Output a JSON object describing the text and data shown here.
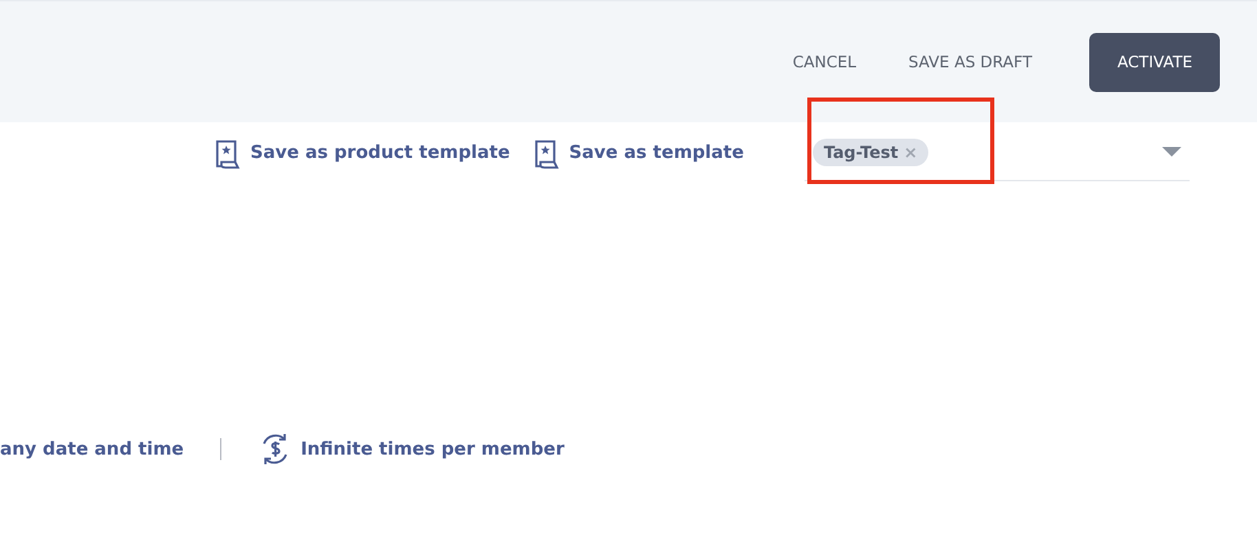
{
  "header": {
    "buttons": [
      {
        "label": "CANCEL",
        "kind": "text"
      },
      {
        "label": "SAVE AS DRAFT",
        "kind": "text"
      },
      {
        "label": "ACTIVATE",
        "kind": "primary"
      }
    ]
  },
  "template_links": [
    {
      "label": "Save as product template"
    },
    {
      "label": "Save as template"
    }
  ],
  "tag_field": {
    "tags": [
      {
        "label": "Tag-Test",
        "remove": "×"
      }
    ],
    "highlighted": true
  },
  "summary": [
    {
      "label": "any date and time",
      "kind": "plain"
    },
    {
      "label": "Infinite times per member",
      "kind": "frequency"
    }
  ]
}
